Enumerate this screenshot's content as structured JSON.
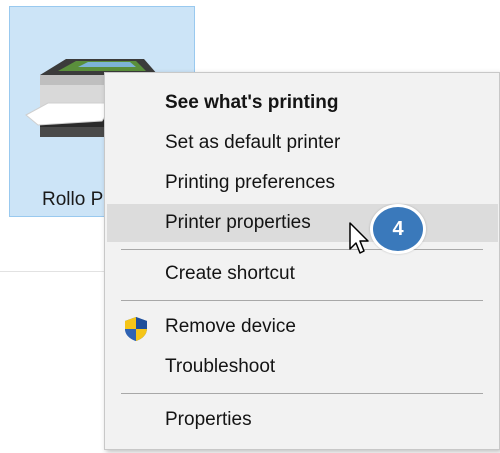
{
  "device": {
    "label": "Rollo P",
    "icon": "printer-icon"
  },
  "context_menu": {
    "items": [
      {
        "label": "See what's printing",
        "bold": true
      },
      {
        "label": "Set as default printer"
      },
      {
        "label": "Printing preferences"
      },
      {
        "label": "Printer properties",
        "highlighted": true
      },
      {
        "label": "Create shortcut"
      },
      {
        "label": "Remove device",
        "icon": "uac-shield-icon"
      },
      {
        "label": "Troubleshoot"
      },
      {
        "label": "Properties"
      }
    ]
  },
  "annotation": {
    "step_number": "4",
    "badge_color": "#3a79bb"
  },
  "colors": {
    "tile_selected_bg": "#cce4f7",
    "menu_bg": "#f2f2f2",
    "menu_highlight": "#dcdcdc"
  }
}
